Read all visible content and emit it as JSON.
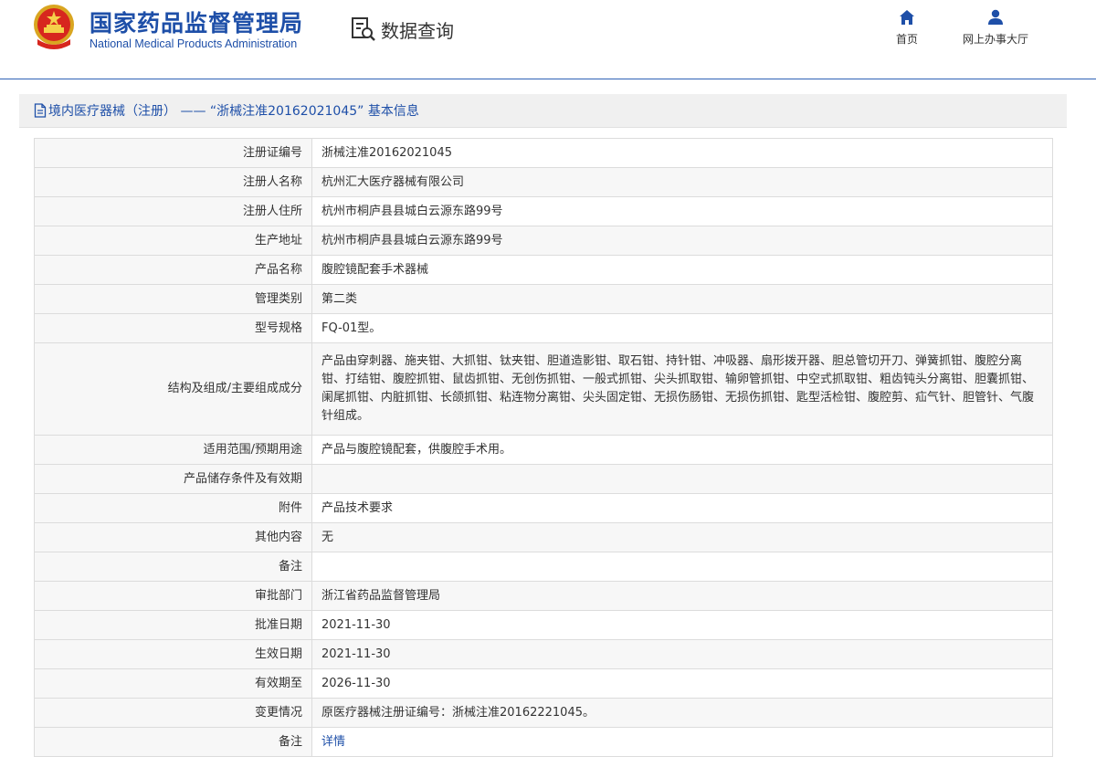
{
  "header": {
    "brand_cn": "国家药品监督管理局",
    "brand_en": "National Medical Products Administration",
    "page_heading": "数据查询",
    "nav": [
      {
        "label": "首页",
        "icon": "home-icon"
      },
      {
        "label": "网上办事大厅",
        "icon": "user-icon"
      }
    ]
  },
  "panel": {
    "title": "境内医疗器械（注册） —— “浙械注准20162021045” 基本信息"
  },
  "colors": {
    "brand_blue": "#1e4fa8",
    "header_rule": "#2f63b6",
    "row_alt": "#f7f7f7"
  },
  "fields": [
    {
      "label": "注册证编号",
      "value": "浙械注准20162021045"
    },
    {
      "label": "注册人名称",
      "value": "杭州汇大医疗器械有限公司"
    },
    {
      "label": "注册人住所",
      "value": "杭州市桐庐县县城白云源东路99号"
    },
    {
      "label": "生产地址",
      "value": "杭州市桐庐县县城白云源东路99号"
    },
    {
      "label": "产品名称",
      "value": "腹腔镜配套手术器械"
    },
    {
      "label": "管理类别",
      "value": "第二类"
    },
    {
      "label": "型号规格",
      "value": "FQ-01型。"
    },
    {
      "label": "结构及组成/主要组成成分",
      "value": "产品由穿刺器、施夹钳、大抓钳、钛夹钳、胆道造影钳、取石钳、持针钳、冲吸器、扇形拨开器、胆总管切开刀、弹簧抓钳、腹腔分离钳、打结钳、腹腔抓钳、鼠齿抓钳、无创伤抓钳、一般式抓钳、尖头抓取钳、输卵管抓钳、中空式抓取钳、粗齿钝头分离钳、胆囊抓钳、阑尾抓钳、内脏抓钳、长颌抓钳、粘连物分离钳、尖头固定钳、无损伤肠钳、无损伤抓钳、匙型活检钳、腹腔剪、疝气针、胆管针、气腹针组成。"
    },
    {
      "label": "适用范围/预期用途",
      "value": "产品与腹腔镜配套，供腹腔手术用。"
    },
    {
      "label": "产品储存条件及有效期",
      "value": ""
    },
    {
      "label": "附件",
      "value": "产品技术要求"
    },
    {
      "label": "其他内容",
      "value": "无"
    },
    {
      "label": "备注",
      "value": ""
    },
    {
      "label": "审批部门",
      "value": "浙江省药品监督管理局"
    },
    {
      "label": "批准日期",
      "value": "2021-11-30"
    },
    {
      "label": "生效日期",
      "value": "2021-11-30"
    },
    {
      "label": "有效期至",
      "value": "2026-11-30"
    },
    {
      "label": "变更情况",
      "value": "原医疗器械注册证编号：浙械注准20162221045。"
    },
    {
      "label": "备注",
      "value": "详情"
    }
  ]
}
